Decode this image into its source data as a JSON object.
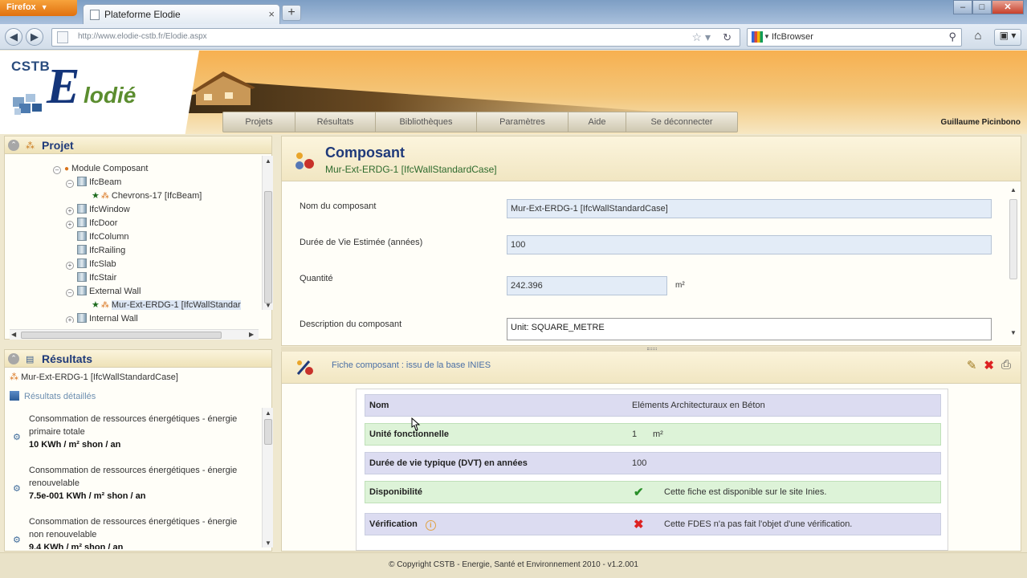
{
  "browser": {
    "app_button": "Firefox",
    "tab_title": "Plateforme Elodie",
    "url": "http://www.elodie-cstb.fr/Elodie.aspx",
    "search_engine_text": "IfcBrowser"
  },
  "header": {
    "cstb": "CSTB",
    "logo_big": "E",
    "logo_rest": "lodié",
    "menu": [
      "Projets",
      "Résultats",
      "Bibliothèques",
      "Paramètres",
      "Aide",
      "Se déconnecter"
    ],
    "user": "Guillaume Picinbono"
  },
  "project_panel": {
    "title": "Projet",
    "tree": [
      {
        "label": "Module Composant",
        "toggle": "⊖"
      },
      {
        "label": "IfcBeam",
        "toggle": "⊖"
      },
      {
        "label": "Chevrons-17 [IfcBeam]",
        "toggle": ""
      },
      {
        "label": "IfcWindow",
        "toggle": "⊕"
      },
      {
        "label": "IfcDoor",
        "toggle": "⊕"
      },
      {
        "label": "IfcColumn",
        "toggle": ""
      },
      {
        "label": "IfcRailing",
        "toggle": ""
      },
      {
        "label": "IfcSlab",
        "toggle": "⊕"
      },
      {
        "label": "IfcStair",
        "toggle": ""
      },
      {
        "label": "External Wall",
        "toggle": "⊖"
      },
      {
        "label": "Mur-Ext-ERDG-1 [IfcWallStandar",
        "toggle": ""
      },
      {
        "label": "Internal Wall",
        "toggle": "⊕"
      }
    ]
  },
  "results_panel": {
    "title": "Résultats",
    "item": "Mur-Ext-ERDG-1 [IfcWallStandardCase]",
    "details_link": "Résultats détaillés",
    "entries": [
      {
        "text": "Consommation de ressources énergétiques - énergie primaire totale",
        "value": "10 KWh / m² shon / an"
      },
      {
        "text": "Consommation de ressources énergétiques - énergie renouvelable",
        "value": "7.5e-001 KWh / m² shon / an"
      },
      {
        "text": "Consommation de ressources énergétiques - énergie non renouvelable",
        "value": "9.4 KWh / m² shon / an"
      }
    ]
  },
  "component_panel": {
    "title": "Composant",
    "subtitle": "Mur-Ext-ERDG-1 [IfcWallStandardCase]",
    "fields": {
      "name_label": "Nom du composant",
      "name_value": "Mur-Ext-ERDG-1 [IfcWallStandardCase]",
      "life_label": "Durée de Vie Estimée (années)",
      "life_value": "100",
      "qty_label": "Quantité",
      "qty_value": "242.396",
      "qty_unit": "m²",
      "desc_label": "Description du composant",
      "desc_value": "Unit: SQUARE_METRE"
    }
  },
  "fiche_panel": {
    "title": "Fiche composant : issu de la base INIES",
    "rows": {
      "nom_k": "Nom",
      "nom_v": "Eléments Architecturaux en Béton",
      "unite_k": "Unité fonctionnelle",
      "unite_v": "1",
      "unite_u": "m²",
      "dvt_k": "Durée de vie typique (DVT) en années",
      "dvt_v": "100",
      "dispo_k": "Disponibilité",
      "dispo_v": "Cette fiche est disponible sur le site Inies.",
      "verif_k": "Vérification",
      "verif_v": "Cette FDES n'a pas fait l'objet d'une vérification."
    }
  },
  "footer": "© Copyright CSTB - Energie, Santé et Environnement 2010 - v1.2.001"
}
